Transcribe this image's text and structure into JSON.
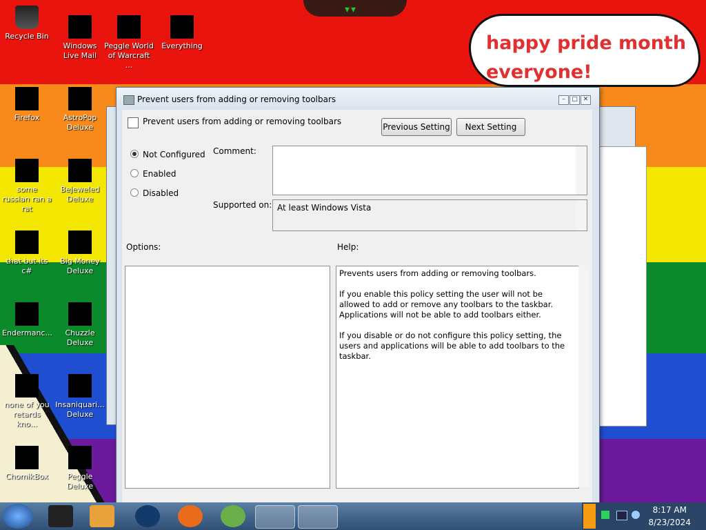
{
  "wallpaper": {
    "bubble_text": "happy pride month everyone!"
  },
  "desktop_icons": [
    {
      "label": "Recycle Bin"
    },
    {
      "label": "Windows Live Mail"
    },
    {
      "label": "Peggle World of Warcraft ..."
    },
    {
      "label": "Everything"
    },
    {
      "label": "Firefox"
    },
    {
      "label": "AstroPop Deluxe"
    },
    {
      "label": "some russian ran a rat"
    },
    {
      "label": "Bejeweled Deluxe"
    },
    {
      "label": "that but its c#"
    },
    {
      "label": "Big Money Deluxe"
    },
    {
      "label": "Endermanc..."
    },
    {
      "label": "Chuzzle Deluxe"
    },
    {
      "label": "none of you retards kno..."
    },
    {
      "label": "Insaniquari... Deluxe"
    },
    {
      "label": "ChomikBox"
    },
    {
      "label": "Peggle Deluxe"
    }
  ],
  "dialog": {
    "title": "Prevent users from adding or removing toolbars",
    "header": "Prevent users from adding or removing toolbars",
    "prev_button": "Previous Setting",
    "next_button": "Next Setting",
    "radios": [
      {
        "label": "Not Configured",
        "selected": true
      },
      {
        "label": "Enabled",
        "selected": false
      },
      {
        "label": "Disabled",
        "selected": false
      }
    ],
    "comment_label": "Comment:",
    "comment_value": "",
    "supported_label": "Supported on:",
    "supported_value": "At least Windows Vista",
    "options_label": "Options:",
    "help_label": "Help:",
    "help_paragraphs": [
      "Prevents users from adding or removing toolbars.",
      "If you enable this policy setting the user will not be allowed to add or remove any toolbars to the taskbar. Applications will not be able to add toolbars either.",
      "If you disable or do not configure this policy setting, the users and applications will be able to add toolbars to the taskbar."
    ]
  },
  "taskbar": {
    "time": "8:17 AM",
    "date": "8/23/2024"
  }
}
